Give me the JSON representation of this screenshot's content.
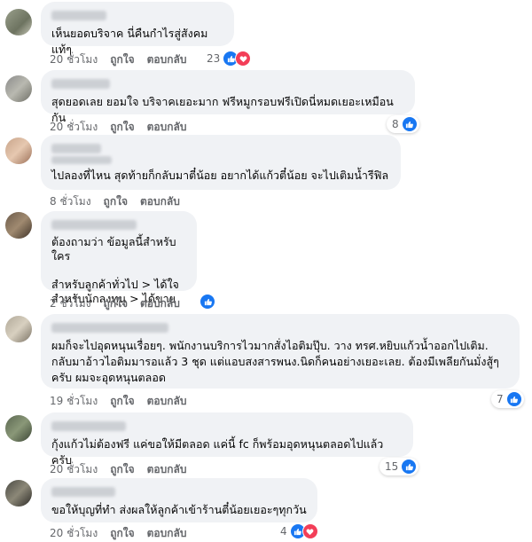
{
  "actions": {
    "like_label": "ถูกใจ",
    "reply_label": "ตอบกลับ"
  },
  "colors": {
    "like": "#1877f2",
    "love": "#f33e58",
    "meta": "#65676b",
    "bubble": "#f0f2f5"
  },
  "comments": [
    {
      "text": "เห็นยอดบริจาค นี่คืนกำไรสู่สังคมแท้ๆ",
      "time": "20 ชั่วโมง",
      "reactions": "23",
      "icons": [
        "like-icon",
        "love-icon"
      ]
    },
    {
      "text": "สุดยอดเลย ยอมใจ บริจาคเยอะมาก ฟรีหมูกรอบฟรีเปิดนี่หมดเยอะเหมือนกัน",
      "time": "20 ชั่วโมง",
      "reactions": "8",
      "icons": [
        "like-icon"
      ]
    },
    {
      "text": "ไปลองที่ไหน สุดท้ายก็กลับมาตี๋น้อย อยากได้แก้วตี๋น้อย จะไปเติมน้ำรีฟิล",
      "time": "8 ชั่วโมง",
      "reactions": "",
      "icons": []
    },
    {
      "text": "ต้องถามว่า ข้อมูลนี้สำหรับใคร\n\nสำหรับลูกค้าทั่วไป > ได้ใจ\nสำหรับนักลงทุน > ได้ขาย",
      "time": "2 ชั่วโมง",
      "reactions": "",
      "icons": [
        "like-icon"
      ]
    },
    {
      "text": "ผมก็จะไปอุดหนุนเรื่อยๆ. พนักงานบริการไวมากสั่งไอติมปุ๊บ. วาง ทรศ.หยิบแก้วน้ำออกไปเติม.\nกลับมาอ้าวไอติมมารอแล้ว 3 ชุด แต่แอบสงสารพนง.นิดก็คนอย่างเยอะเลย. ต้องมีเพลียกันมั่งสู้ๆ\nครับ ผมจะอุดหนุนตลอด",
      "time": "19 ชั่วโมง",
      "reactions": "7",
      "icons": [
        "like-icon"
      ]
    },
    {
      "text": "กุ้งแก้วไม่ต้องฟรี แค่ขอให้มีตลอด แค่นี้ fc ก็พร้อมอุดหนุนตลอดไปแล้วครับ",
      "time": "20 ชั่วโมง",
      "reactions": "15",
      "icons": [
        "like-icon"
      ]
    },
    {
      "text": "ขอให้บุญที่ทำ ส่งผลให้ลูกค้าเข้าร้านตี๋น้อยเยอะๆทุกวัน",
      "time": "20 ชั่วโมง",
      "reactions": "4",
      "icons": [
        "like-icon",
        "love-icon"
      ]
    }
  ]
}
